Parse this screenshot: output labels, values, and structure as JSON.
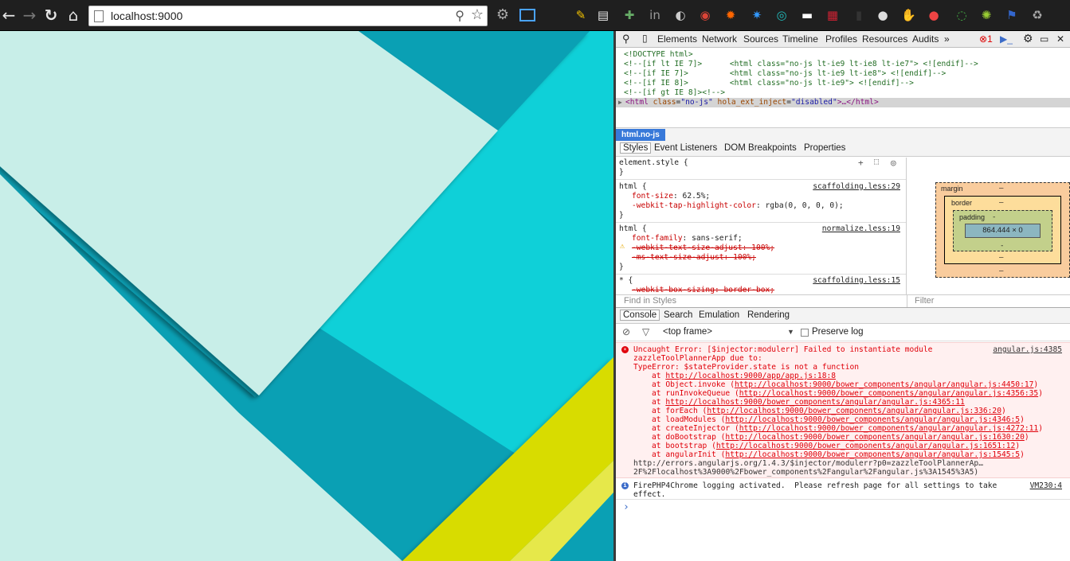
{
  "browser": {
    "url": "localhost:9000",
    "nav": {
      "back": "←",
      "forward": "→",
      "reload": "↻",
      "home": "⌂"
    },
    "extension_icons": [
      "pen-icon",
      "notes-icon",
      "puzzle-icon",
      "linkedin-icon",
      "sync-icon",
      "chrome-icon",
      "fox-icon",
      "bug-icon",
      "speed-icon",
      "window-icon",
      "grid-icon",
      "phone-icon",
      "chat-icon",
      "stop-icon",
      "color-dot-icon",
      "refresh-icon",
      "wheel-icon",
      "flag-icon",
      "recycle-icon"
    ]
  },
  "page": {
    "colors": {
      "teal_dark": "#0aa0b4",
      "teal_bright": "#0fd0d8",
      "mint": "#c8eee8",
      "yellow": "#d8dc00",
      "yellow_light": "#e6e84a"
    }
  },
  "devtools": {
    "tabs": [
      "Elements",
      "Network",
      "Sources",
      "Timeline",
      "Profiles",
      "Resources",
      "Audits"
    ],
    "more": "»",
    "error_count": "1",
    "dom_lines": [
      "<!DOCTYPE html>",
      "<!--[if lt IE 7]>      <html class=\"no-js lt-ie9 lt-ie8 lt-ie7\"> <![endif]-->",
      "<!--[if IE 7]>         <html class=\"no-js lt-ie9 lt-ie8\"> <![endif]-->",
      "<!--[if IE 8]>         <html class=\"no-js lt-ie9\"> <![endif]-->",
      "<!--[if gt IE 8]><!-->"
    ],
    "dom_selected": {
      "tag_open": "<html ",
      "a1": "class",
      "v1": "\"no-js\"",
      "a2": "hola_ext_inject",
      "v2": "\"disabled\"",
      "tail": ">…</html>"
    },
    "breadcrumb": "html.no-js",
    "styles_tabs": [
      "Styles",
      "Event Listeners",
      "DOM Breakpoints",
      "Properties"
    ],
    "styles": {
      "element_style": "element.style {",
      "close": "}",
      "rule1_selector": "html {",
      "rule1_source": "scaffolding.less:29",
      "rule1_p1": "font-size",
      "rule1_v1": "62.5%;",
      "rule1_p2": "-webkit-tap-highlight-color",
      "rule1_v2": "rgba(0, 0, 0, 0);",
      "rule2_selector": "html {",
      "rule2_source": "normalize.less:19",
      "rule2_p1": "font-family",
      "rule2_v1": "sans-serif;",
      "rule2_s1": "-webkit-text-size-adjust: 100%;",
      "rule2_s2": "-ms-text-size-adjust: 100%;",
      "rule3_selector": "* {",
      "rule3_source": "scaffolding.less:15",
      "rule3_s1": "-webkit-box-sizing: border-box;"
    },
    "box_model": {
      "margin": "margin",
      "border": "border",
      "padding": "padding",
      "content": "864.444 × 0",
      "dash": "–",
      "dash2": "-"
    },
    "find_in_styles": "Find in Styles",
    "filter": "Filter",
    "console_tabs": [
      "Console",
      "Search",
      "Emulation",
      "Rendering"
    ],
    "frame_select": "<top frame>",
    "preserve_log": "Preserve log",
    "error": {
      "source": "angular.js:4385",
      "lines": [
        "Uncaught Error: [$injector:modulerr] Failed to instantiate module",
        "zazzleToolPlannerApp due to:",
        "TypeError: $stateProvider.state is not a function"
      ],
      "stack": [
        {
          "fn": "at ",
          "url": "http://localhost:9000/app/app.js:18:8"
        },
        {
          "fn": "at Object.invoke (",
          "url": "http://localhost:9000/bower_components/angular/angular.js:4450:17",
          "end": ")"
        },
        {
          "fn": "at runInvokeQueue (",
          "url": "http://localhost:9000/bower_components/angular/angular.js:4356:35",
          "end": ")"
        },
        {
          "fn": "at ",
          "url": "http://localhost:9000/bower_components/angular/angular.js:4365:11"
        },
        {
          "fn": "at forEach (",
          "url": "http://localhost:9000/bower_components/angular/angular.js:336:20",
          "end": ")"
        },
        {
          "fn": "at loadModules (",
          "url": "http://localhost:9000/bower_components/angular/angular.js:4346:5",
          "end": ")"
        },
        {
          "fn": "at createInjector (",
          "url": "http://localhost:9000/bower_components/angular/angular.js:4272:11",
          "end": ")"
        },
        {
          "fn": "at doBootstrap (",
          "url": "http://localhost:9000/bower_components/angular/angular.js:1630:20",
          "end": ")"
        },
        {
          "fn": "at bootstrap (",
          "url": "http://localhost:9000/bower_components/angular/angular.js:1651:12",
          "end": ")"
        },
        {
          "fn": "at angularInit (",
          "url": "http://localhost:9000/bower_components/angular/angular.js:1545:5",
          "end": ")"
        }
      ],
      "tail1": "http://errors.angularjs.org/1.4.3/$injector/modulerr?p0=zazzleToolPlannerAp…",
      "tail2": "2F%2Flocalhost%3A9000%2Fbower_components%2Fangular%2Fangular.js%3A1545%3A5)"
    },
    "info": {
      "line1": "FirePHP4Chrome logging activated.  Please refresh page for all settings to take",
      "line2": "effect.",
      "source": "VM230:4"
    },
    "prompt": "›"
  }
}
